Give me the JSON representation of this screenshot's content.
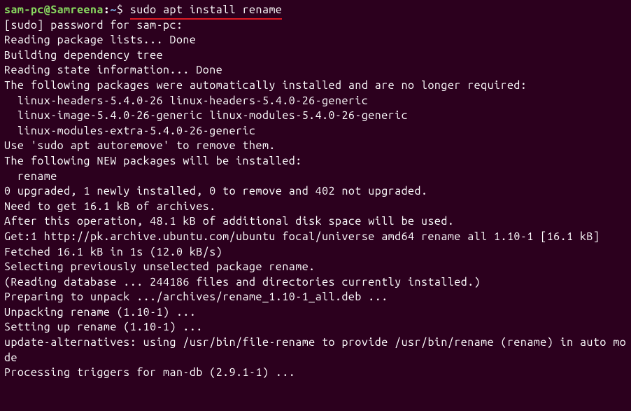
{
  "prompt": {
    "user": "sam-pc",
    "at": "@",
    "host": "Samreena",
    "colon": ":",
    "path": "~",
    "dollar": "$ "
  },
  "command": "sudo apt install rename",
  "output_lines": [
    "[sudo] password for sam-pc:",
    "Reading package lists... Done",
    "Building dependency tree",
    "Reading state information... Done",
    "The following packages were automatically installed and are no longer required:",
    "  linux-headers-5.4.0-26 linux-headers-5.4.0-26-generic",
    "  linux-image-5.4.0-26-generic linux-modules-5.4.0-26-generic",
    "  linux-modules-extra-5.4.0-26-generic",
    "Use 'sudo apt autoremove' to remove them.",
    "The following NEW packages will be installed:",
    "  rename",
    "0 upgraded, 1 newly installed, 0 to remove and 402 not upgraded.",
    "Need to get 16.1 kB of archives.",
    "After this operation, 48.1 kB of additional disk space will be used.",
    "Get:1 http://pk.archive.ubuntu.com/ubuntu focal/universe amd64 rename all 1.10-1 [16.1 kB]",
    "Fetched 16.1 kB in 1s (12.0 kB/s)",
    "Selecting previously unselected package rename.",
    "(Reading database ... 244186 files and directories currently installed.)",
    "Preparing to unpack .../archives/rename_1.10-1_all.deb ...",
    "Unpacking rename (1.10-1) ...",
    "Setting up rename (1.10-1) ...",
    "update-alternatives: using /usr/bin/file-rename to provide /usr/bin/rename (rename) in auto mode",
    "Processing triggers for man-db (2.9.1-1) ..."
  ]
}
